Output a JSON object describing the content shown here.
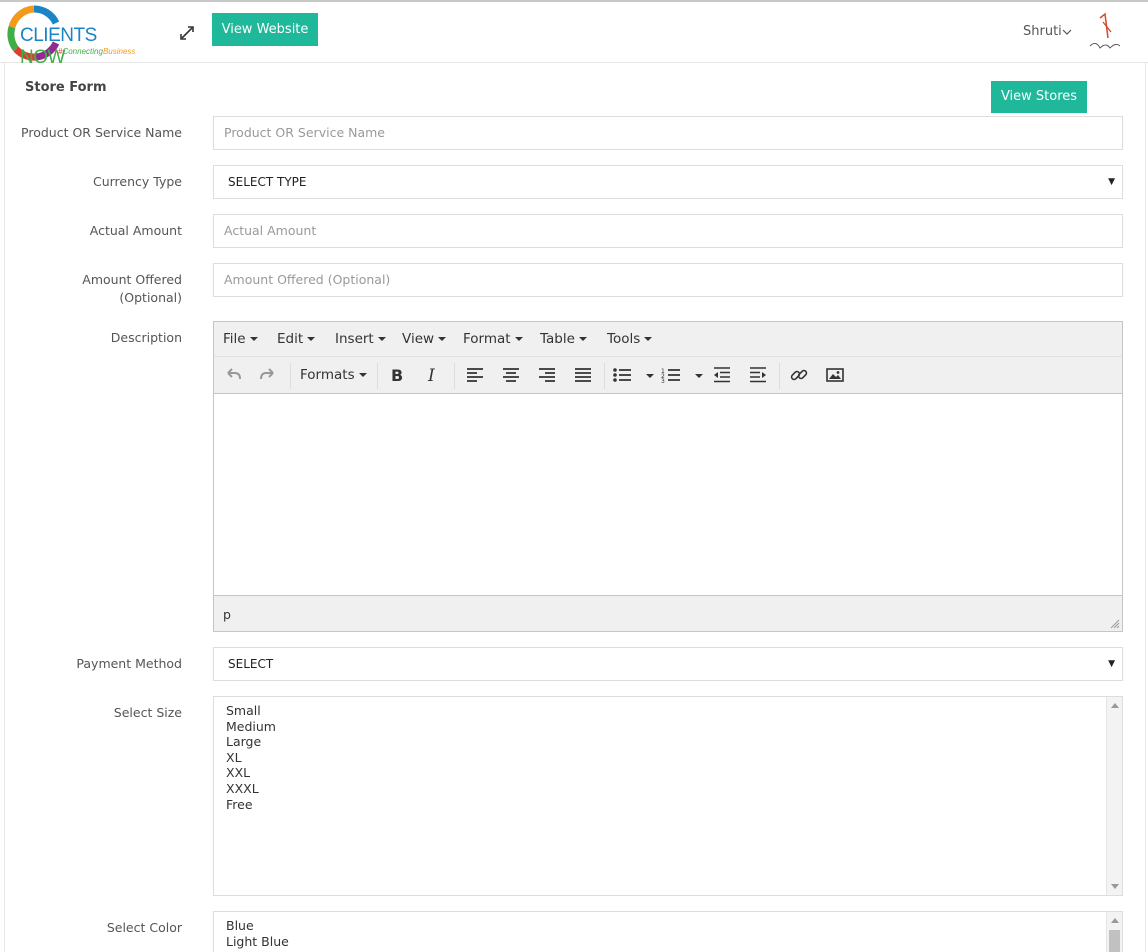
{
  "header": {
    "logo": {
      "word1": "CLIENTS",
      "word2": "NOW",
      "tag_hash": "#",
      "tag1": "Connecting",
      "tag2": "Business"
    },
    "view_website_label": "View Website",
    "user_name": "Shruti",
    "icons": {
      "expand": "expand-arrows-icon",
      "user_menu": "chevron-down-icon",
      "avatar": "signature-avatar"
    }
  },
  "form": {
    "title": "Store Form",
    "view_stores_label": "View Stores",
    "fields": {
      "product_name": {
        "label": "Product OR Service Name",
        "placeholder": "Product OR Service Name"
      },
      "currency_type": {
        "label": "Currency Type",
        "selected": "SELECT TYPE"
      },
      "actual_amount": {
        "label": "Actual Amount",
        "placeholder": "Actual Amount"
      },
      "amount_offered": {
        "label_line1": "Amount Offered",
        "label_line2": "(Optional)",
        "placeholder": "Amount Offered (Optional)"
      },
      "description": {
        "label": "Description"
      },
      "payment_method": {
        "label": "Payment Method",
        "selected": "SELECT"
      },
      "select_size": {
        "label": "Select Size",
        "options": [
          "Small",
          "Medium",
          "Large",
          "XL",
          "XXL",
          "XXXL",
          "Free"
        ]
      },
      "select_color": {
        "label": "Select Color",
        "options": [
          "Blue",
          "Light Blue"
        ]
      }
    }
  },
  "editor": {
    "menus": [
      "File",
      "Edit",
      "Insert",
      "View",
      "Format",
      "Table",
      "Tools"
    ],
    "formats_label": "Formats",
    "status_path": "p",
    "toolbar_icons": [
      "undo-icon",
      "redo-icon",
      "bold-icon",
      "italic-icon",
      "align-left-icon",
      "align-center-icon",
      "align-right-icon",
      "align-justify-icon",
      "bullet-list-icon",
      "numbered-list-icon",
      "outdent-icon",
      "indent-icon",
      "link-icon",
      "image-icon"
    ]
  },
  "colors": {
    "accent": "#20b89b"
  }
}
